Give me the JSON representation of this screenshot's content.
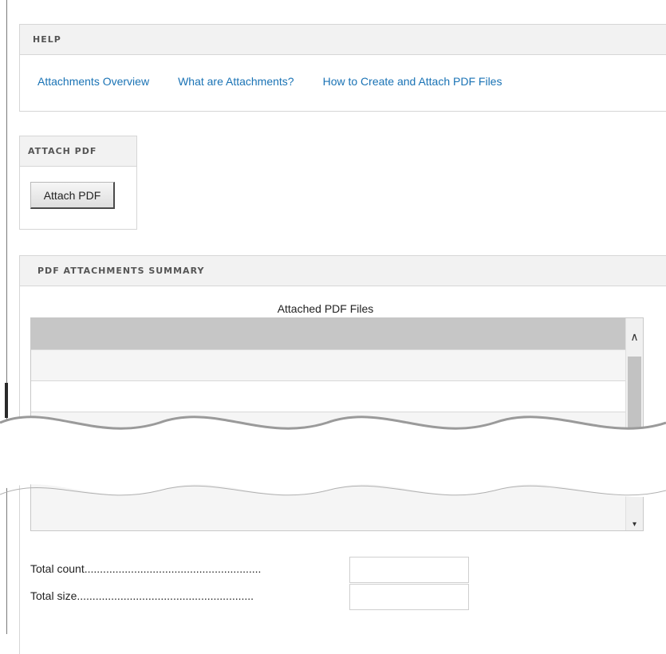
{
  "help": {
    "title": "HELP",
    "links": [
      "Attachments Overview",
      "What are Attachments?",
      "How to Create and Attach PDF Files"
    ]
  },
  "attach": {
    "title": "ATTACH PDF",
    "button_label": "Attach PDF"
  },
  "summary": {
    "title": "PDF ATTACHMENTS SUMMARY",
    "list_title": "Attached PDF Files"
  },
  "totals": {
    "count_label": "Total count.........................................................",
    "count_value": "",
    "size_label": "Total size.........................................................",
    "size_value": ""
  },
  "icons": {
    "scroll_up": "chevron-up-icon",
    "scroll_down": "triangle-down-icon"
  }
}
